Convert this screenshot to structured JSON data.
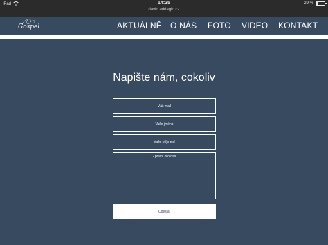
{
  "statusbar": {
    "device": "iPad",
    "time": "14:25",
    "url": "david.addagio.cz",
    "battery": "29 %",
    "battery_level": 0.29
  },
  "header": {
    "logo_text": "Gospel",
    "nav": [
      "AKTUÁLNĚ",
      "O NÁS",
      "FOTO",
      "VIDEO",
      "KONTAKT"
    ]
  },
  "form": {
    "heading": "Napište nám, cokoliv",
    "email_placeholder": "Váš mail",
    "firstname_placeholder": "Vaše jméno",
    "lastname_placeholder": "Vaše příjmení",
    "message_placeholder": "Zpráva pro nás",
    "submit_label": "Odeslat"
  }
}
